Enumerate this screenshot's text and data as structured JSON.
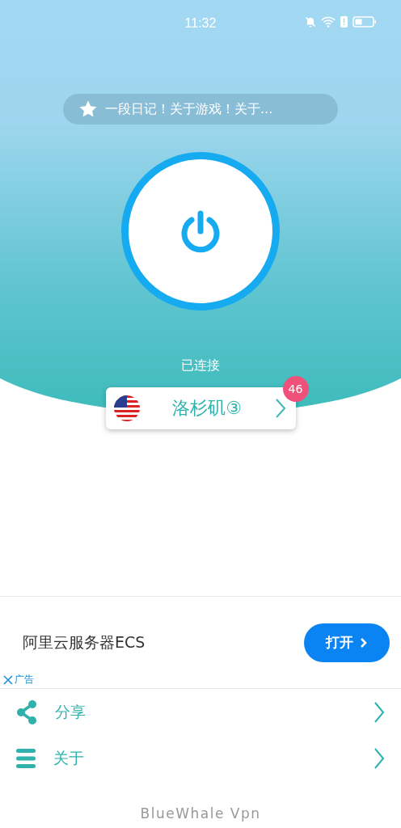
{
  "status_bar": {
    "time": "11:32"
  },
  "ticker": {
    "text": "一段日记！关于游戏！关于..."
  },
  "connection": {
    "status": "已连接",
    "connected": true
  },
  "server": {
    "name": "洛杉矶③",
    "badge": "46"
  },
  "ad": {
    "title": "阿里云服务器ECS",
    "button": "打开",
    "label": "广告"
  },
  "menu": [
    {
      "kind": "share",
      "label": "分享"
    },
    {
      "kind": "about",
      "label": "关于"
    }
  ],
  "footer": "BlueWhale Vpn"
}
